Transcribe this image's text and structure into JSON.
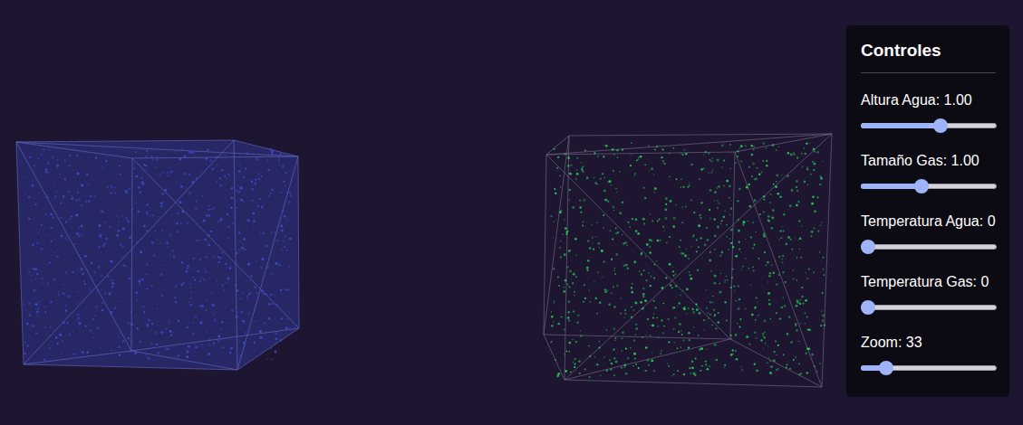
{
  "scene": {
    "containers": [
      {
        "kind": "water",
        "color": "#3d4fd6"
      },
      {
        "kind": "gas",
        "color": "#27d65a"
      }
    ]
  },
  "controls": {
    "title": "Controles",
    "sliders": [
      {
        "label": "Altura Agua: 1.00",
        "level": 0.6
      },
      {
        "label": "Tamaño Gas: 1.00",
        "level": 0.44
      },
      {
        "label": "Temperatura Agua: 0",
        "level": 0
      },
      {
        "label": "Temperatura Gas: 0",
        "level": 0
      },
      {
        "label": "Zoom: 33",
        "level": 0.15
      }
    ]
  }
}
